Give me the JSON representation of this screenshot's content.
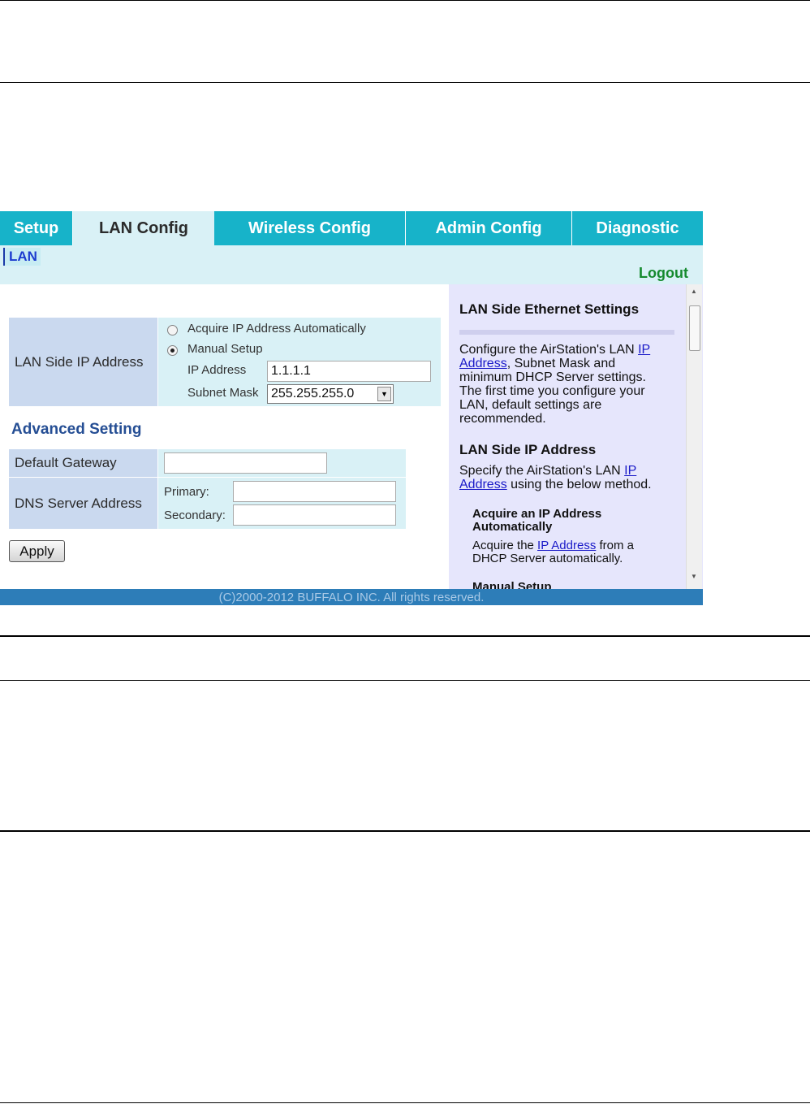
{
  "tabs": [
    {
      "label": "Setup"
    },
    {
      "label": "LAN Config"
    },
    {
      "label": "Wireless Config"
    },
    {
      "label": "Admin Config"
    },
    {
      "label": "Diagnostic"
    }
  ],
  "subnav": {
    "lan": "LAN",
    "logout": "Logout"
  },
  "lan_ip": {
    "label": "LAN Side IP Address",
    "option_auto": "Acquire IP Address Automatically",
    "option_manual": "Manual Setup",
    "ip_label": "IP Address",
    "ip_value": "1.1.1.1",
    "mask_label": "Subnet Mask",
    "mask_value": "255.255.255.0"
  },
  "advanced": {
    "title": "Advanced Setting",
    "gateway_label": "Default Gateway",
    "gateway_value": "",
    "dns_label": "DNS Server Address",
    "primary_label": "Primary:",
    "primary_value": "",
    "secondary_label": "Secondary:",
    "secondary_value": ""
  },
  "apply_label": "Apply",
  "help": {
    "title1": "LAN Side Ethernet Settings",
    "p1_a": "Configure the AirStation's LAN ",
    "p1_link": "IP Address",
    "p1_b": ", Subnet Mask and minimum DHCP Server settings. The first time you configure your LAN, default settings are recommended.",
    "title2": "LAN Side IP Address",
    "p2_a": "Specify the AirStation's LAN ",
    "p2_link": "IP Address",
    "p2_b": " using the below method.",
    "h_auto": "Acquire an IP Address Automatically",
    "p3_a": "Acquire the ",
    "p3_link": "IP Address",
    "p3_b": " from a DHCP Server automatically.",
    "h_manual": "Manual Setup"
  },
  "footer": "(C)2000-2012 BUFFALO INC. All rights reserved."
}
